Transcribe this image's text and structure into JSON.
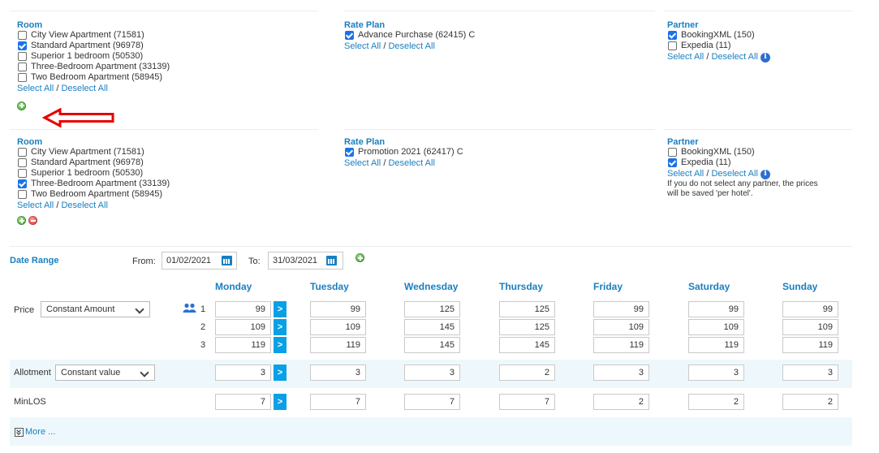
{
  "block1": {
    "room": {
      "title": "Room",
      "items": [
        {
          "label": "City View Apartment (71581)",
          "checked": false
        },
        {
          "label": "Standard Apartment (96978)",
          "checked": true
        },
        {
          "label": "Superior 1 bedroom (50530)",
          "checked": false
        },
        {
          "label": "Three-Bedroom Apartment (33139)",
          "checked": false
        },
        {
          "label": "Two Bedroom Apartment (58945)",
          "checked": false
        }
      ],
      "select_all": "Select All",
      "deselect_all": "Deselect All"
    },
    "rate_plan": {
      "title": "Rate Plan",
      "items": [
        {
          "label": "Advance Purchase (62415)  C",
          "checked": true
        }
      ],
      "select_all": "Select All",
      "deselect_all": "Deselect All"
    },
    "partner": {
      "title": "Partner",
      "items": [
        {
          "label": "BookingXML (150)",
          "checked": true
        },
        {
          "label": "Expedia (11)",
          "checked": false
        }
      ],
      "select_all": "Select All",
      "deselect_all": "Deselect All"
    }
  },
  "block2": {
    "room": {
      "title": "Room",
      "items": [
        {
          "label": "City View Apartment (71581)",
          "checked": false
        },
        {
          "label": "Standard Apartment (96978)",
          "checked": false
        },
        {
          "label": "Superior 1 bedroom (50530)",
          "checked": false
        },
        {
          "label": "Three-Bedroom Apartment (33139)",
          "checked": true
        },
        {
          "label": "Two Bedroom Apartment (58945)",
          "checked": false
        }
      ],
      "select_all": "Select All",
      "deselect_all": "Deselect All"
    },
    "rate_plan": {
      "title": "Rate Plan",
      "items": [
        {
          "label": "Promotion 2021 (62417)  C",
          "checked": true
        }
      ],
      "select_all": "Select All",
      "deselect_all": "Deselect All"
    },
    "partner": {
      "title": "Partner",
      "items": [
        {
          "label": "BookingXML (150)",
          "checked": false
        },
        {
          "label": "Expedia (11)",
          "checked": true
        }
      ],
      "select_all": "Select All",
      "deselect_all": "Deselect All",
      "note_line1": "If you do not select any partner, the prices",
      "note_line2": "will be saved 'per hotel'."
    }
  },
  "sep": "/",
  "date_range": {
    "label": "Date Range",
    "from_label": "From:",
    "from_value": "01/02/2021",
    "to_label": "To:",
    "to_value": "31/03/2021"
  },
  "days": [
    "Monday",
    "Tuesday",
    "Wednesday",
    "Thursday",
    "Friday",
    "Saturday",
    "Sunday"
  ],
  "price": {
    "label": "Price",
    "mode": "Constant Amount",
    "occupancy": [
      "1",
      "2",
      "3"
    ],
    "rows": [
      [
        "99",
        "99",
        "125",
        "125",
        "99",
        "99",
        "99"
      ],
      [
        "109",
        "109",
        "145",
        "125",
        "109",
        "109",
        "109"
      ],
      [
        "119",
        "119",
        "145",
        "145",
        "119",
        "119",
        "119"
      ]
    ]
  },
  "allotment": {
    "label": "Allotment",
    "mode": "Constant value",
    "values": [
      "3",
      "3",
      "3",
      "2",
      "3",
      "3",
      "3"
    ]
  },
  "minlos": {
    "label": "MinLOS",
    "values": [
      "7",
      "7",
      "7",
      "7",
      "2",
      "2",
      "2"
    ]
  },
  "apply_glyph": ">",
  "more_label": "More ...",
  "colors": {
    "accent": "#1a7fc1",
    "apply_button": "#0aa0e6",
    "annotation_arrow": "#e60000",
    "row_band": "#eef8fc"
  }
}
